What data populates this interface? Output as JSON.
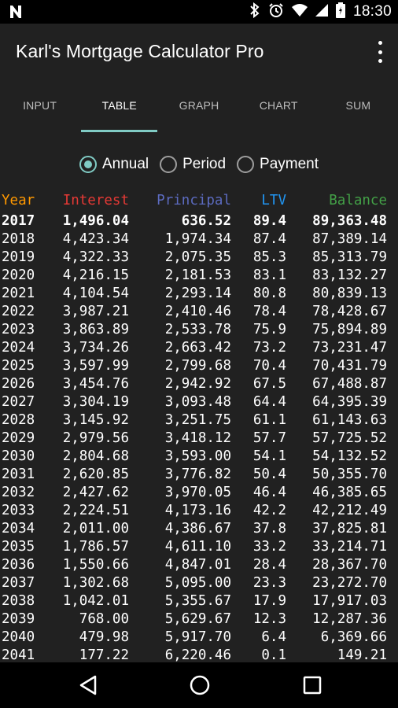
{
  "status": {
    "time": "18:30"
  },
  "app": {
    "title": "Karl's Mortgage Calculator Pro"
  },
  "tabs": [
    {
      "label": "INPUT"
    },
    {
      "label": "TABLE"
    },
    {
      "label": "GRAPH"
    },
    {
      "label": "CHART"
    },
    {
      "label": "SUM"
    }
  ],
  "active_tab": "TABLE",
  "radios": [
    {
      "label": "Annual",
      "checked": true
    },
    {
      "label": "Period",
      "checked": false
    },
    {
      "label": "Payment",
      "checked": false
    }
  ],
  "table": {
    "headers": [
      "Year",
      "Interest",
      "Principal",
      "LTV",
      "Balance"
    ],
    "rows": [
      [
        "2017",
        "1,496.04",
        "636.52",
        "89.4",
        "89,363.48"
      ],
      [
        "2018",
        "4,423.34",
        "1,974.34",
        "87.4",
        "87,389.14"
      ],
      [
        "2019",
        "4,322.33",
        "2,075.35",
        "85.3",
        "85,313.79"
      ],
      [
        "2020",
        "4,216.15",
        "2,181.53",
        "83.1",
        "83,132.27"
      ],
      [
        "2021",
        "4,104.54",
        "2,293.14",
        "80.8",
        "80,839.13"
      ],
      [
        "2022",
        "3,987.21",
        "2,410.46",
        "78.4",
        "78,428.67"
      ],
      [
        "2023",
        "3,863.89",
        "2,533.78",
        "75.9",
        "75,894.89"
      ],
      [
        "2024",
        "3,734.26",
        "2,663.42",
        "73.2",
        "73,231.47"
      ],
      [
        "2025",
        "3,597.99",
        "2,799.68",
        "70.4",
        "70,431.79"
      ],
      [
        "2026",
        "3,454.76",
        "2,942.92",
        "67.5",
        "67,488.87"
      ],
      [
        "2027",
        "3,304.19",
        "3,093.48",
        "64.4",
        "64,395.39"
      ],
      [
        "2028",
        "3,145.92",
        "3,251.75",
        "61.1",
        "61,143.63"
      ],
      [
        "2029",
        "2,979.56",
        "3,418.12",
        "57.7",
        "57,725.52"
      ],
      [
        "2030",
        "2,804.68",
        "3,593.00",
        "54.1",
        "54,132.52"
      ],
      [
        "2031",
        "2,620.85",
        "3,776.82",
        "50.4",
        "50,355.70"
      ],
      [
        "2032",
        "2,427.62",
        "3,970.05",
        "46.4",
        "46,385.65"
      ],
      [
        "2033",
        "2,224.51",
        "4,173.16",
        "42.2",
        "42,212.49"
      ],
      [
        "2034",
        "2,011.00",
        "4,386.67",
        "37.8",
        "37,825.81"
      ],
      [
        "2035",
        "1,786.57",
        "4,611.10",
        "33.2",
        "33,214.71"
      ],
      [
        "2036",
        "1,550.66",
        "4,847.01",
        "28.4",
        "28,367.70"
      ],
      [
        "2037",
        "1,302.68",
        "5,095.00",
        "23.3",
        "23,272.70"
      ],
      [
        "2038",
        "1,042.01",
        "5,355.67",
        "17.9",
        "17,917.03"
      ],
      [
        "2039",
        "768.00",
        "5,629.67",
        "12.3",
        "12,287.36"
      ],
      [
        "2040",
        "479.98",
        "5,917.70",
        "6.4",
        "6,369.66"
      ],
      [
        "2041",
        "177.22",
        "6,220.46",
        "0.1",
        "149.21"
      ]
    ]
  },
  "colors": {
    "year": "#ff9800",
    "interest": "#e53935",
    "principal": "#5c6bc0",
    "ltv": "#2196f3",
    "balance": "#43a047",
    "accent": "#80cbc4"
  }
}
